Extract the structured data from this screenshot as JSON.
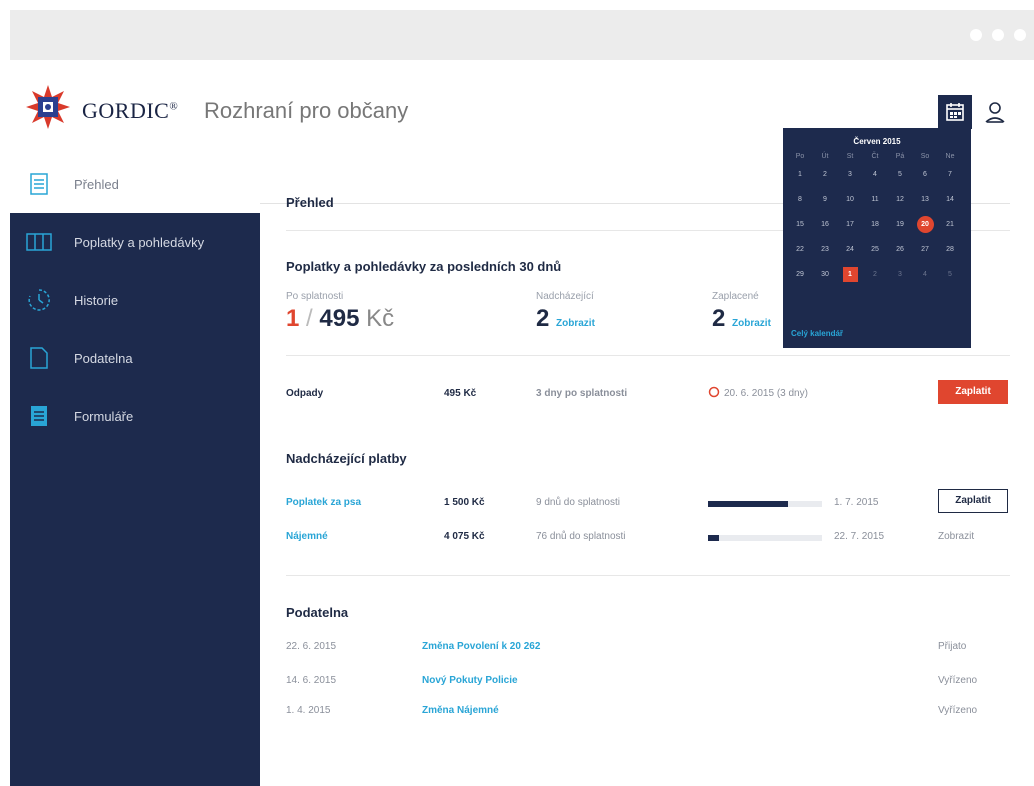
{
  "header": {
    "brand": "GORDIC",
    "brand_mark": "®",
    "subtitle": "Rozhraní pro občany"
  },
  "sidebar": {
    "items": [
      {
        "label": "Přehled",
        "icon": "document-icon",
        "active": true
      },
      {
        "label": "Poplatky a pohledávky",
        "icon": "book-icon"
      },
      {
        "label": "Historie",
        "icon": "clock-icon"
      },
      {
        "label": "Podatelna",
        "icon": "file-icon"
      },
      {
        "label": "Formuláře",
        "icon": "form-icon"
      }
    ]
  },
  "overview": {
    "title": "Přehled",
    "fees_title": "Poplatky a pohledávky za posledních 30 dnů",
    "stats": [
      {
        "label": "Po splatnosti",
        "value_red": "1",
        "value_rest": "495",
        "unit": "Kč",
        "link": ""
      },
      {
        "label": "Nadcházející",
        "value": "2",
        "link": "Zobrazit"
      },
      {
        "label": "Zaplacené",
        "value": "2",
        "link": "Zobrazit"
      }
    ],
    "overdue_row": {
      "name": "Odpady",
      "amount": "495 Kč",
      "days": "3 dny po splatnosti",
      "date": "20. 6. 2015",
      "date_suffix": "(3 dny)",
      "button": "Zaplatit"
    },
    "upcoming_title": "Nadcházející platby",
    "upcoming": [
      {
        "name": "Poplatek za psa",
        "amount": "1 500 Kč",
        "days": "9 dnů do splatnosti",
        "progress": 0.7,
        "date": "1. 7. 2015",
        "action": "Zaplatit"
      },
      {
        "name": "Nájemné",
        "amount": "4 075 Kč",
        "days": "76 dnů do splatnosti",
        "progress": 0.1,
        "date": "22. 7. 2015",
        "action": "Zobrazit"
      }
    ],
    "filing_title": "Podatelna",
    "filings": [
      {
        "date": "22. 6. 2015",
        "title": "Změna Povolení k 20 262",
        "status": "Přijato"
      },
      {
        "date": "14. 6. 2015",
        "title": "Nový Pokuty Policie",
        "status": "Vyřízeno"
      },
      {
        "date": "1. 4. 2015",
        "title": "Změna Nájemné",
        "status": "Vyřízeno"
      }
    ]
  },
  "calendar": {
    "title": "Červen 2015",
    "weekdays": [
      "Po",
      "Út",
      "St",
      "Čt",
      "Pá",
      "So",
      "Ne"
    ],
    "rows": [
      [
        "1",
        "2",
        "3",
        "4",
        "5",
        "6",
        "7"
      ],
      [
        "8",
        "9",
        "10",
        "11",
        "12",
        "13",
        "14"
      ],
      [
        "15",
        "16",
        "17",
        "18",
        "19",
        "20",
        "21"
      ],
      [
        "22",
        "23",
        "24",
        "25",
        "26",
        "27",
        "28"
      ],
      [
        "29",
        "30",
        "1",
        "2",
        "3",
        "4",
        "5"
      ]
    ],
    "today": "20",
    "due": "1",
    "link": "Celý kalendář"
  },
  "colors": {
    "navy": "#1d2a4d",
    "accent_red": "#e0462f",
    "link_blue": "#29a5d6"
  }
}
